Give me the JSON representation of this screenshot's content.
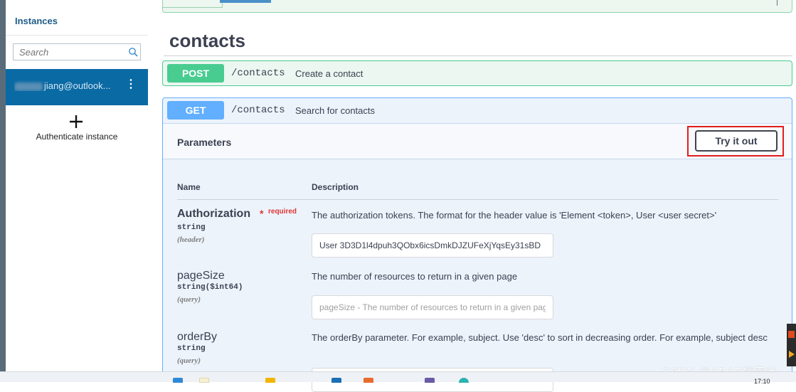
{
  "sidebar": {
    "title": "Instances",
    "search_placeholder": "Search",
    "account_label": "jiang@outlook...",
    "add_label": "Authenticate instance"
  },
  "section": {
    "title": "contacts"
  },
  "operations": [
    {
      "method": "POST",
      "path": "/contacts",
      "summary": "Create a contact",
      "color": "#49cc90"
    },
    {
      "method": "GET",
      "path": "/contacts",
      "summary": "Search for contacts",
      "color": "#61affe"
    }
  ],
  "parameters_panel": {
    "title": "Parameters",
    "try_button": "Try it out",
    "headers": {
      "name": "Name",
      "description": "Description"
    },
    "required_label": "required",
    "required_star": "*",
    "params": [
      {
        "name": "Authorization",
        "type": "string",
        "in": "(header)",
        "description": "The authorization tokens. The format for the header value is 'Element <token>, User <user secret>'",
        "value": "User 3D3D1l4dpuh3QObx6icsDmkDJZUFeXjYqsEy31sBD",
        "placeholder": ""
      },
      {
        "name": "pageSize",
        "type": "string($int64)",
        "in": "(query)",
        "description": "The number of resources to return in a given page",
        "value": "",
        "placeholder": "pageSize - The number of resources to return in a given page"
      },
      {
        "name": "orderBy",
        "type": "string",
        "in": "(query)",
        "description": "The orderBy parameter. For example, subject. Use 'desc' to sort in decreasing order. For example, subject desc",
        "value": "",
        "placeholder": ""
      }
    ]
  },
  "watermark": "CSDN @ABAP探索者",
  "taskbar": {
    "clock": "17:10"
  },
  "colors": {
    "highlight": "#e11d1d",
    "sidebar_active": "#0a6aa4"
  }
}
